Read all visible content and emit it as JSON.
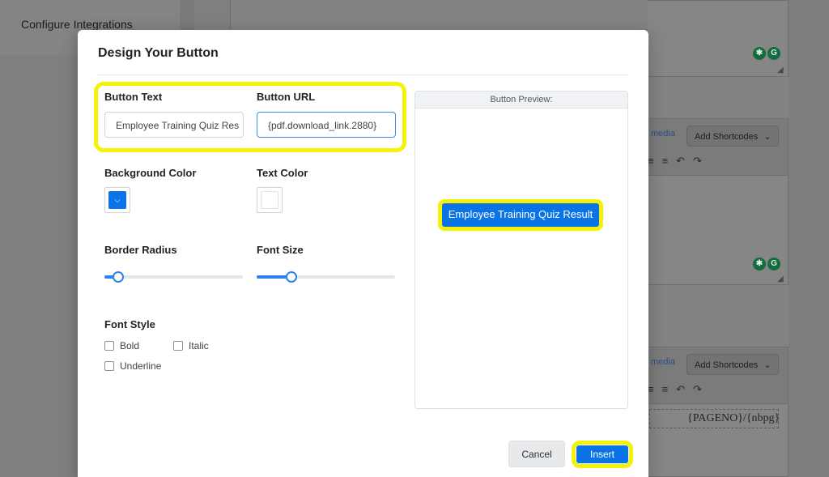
{
  "background": {
    "sidebar_item": "Configure Integrations",
    "editor_media_label": "media",
    "shortcodes_label": "Add Shortcodes",
    "shortcodes_chevron": "⌄",
    "footer_tag": "{PAGENO}/{nbpg}"
  },
  "modal": {
    "title": "Design Your Button",
    "button_text": {
      "label": "Button Text",
      "value": "Employee Training Quiz Res"
    },
    "button_url": {
      "label": "Button URL",
      "value": "{pdf.download_link.2880}"
    },
    "background_color": {
      "label": "Background Color",
      "value": "#0a73e6"
    },
    "text_color": {
      "label": "Text Color",
      "value": "#ffffff"
    },
    "border_radius": {
      "label": "Border Radius",
      "value_fraction": 0.1
    },
    "font_size": {
      "label": "Font Size",
      "value_fraction": 0.25
    },
    "font_style": {
      "label": "Font Style",
      "options": [
        {
          "label": "Bold",
          "checked": false
        },
        {
          "label": "Italic",
          "checked": false
        },
        {
          "label": "Underline",
          "checked": false
        }
      ]
    },
    "preview": {
      "header": "Button Preview:",
      "button_label": "Employee Training Quiz Result"
    },
    "cancel_label": "Cancel",
    "insert_label": "Insert"
  },
  "colors": {
    "highlight": "#f3f30a",
    "accent": "#0a73e6"
  }
}
